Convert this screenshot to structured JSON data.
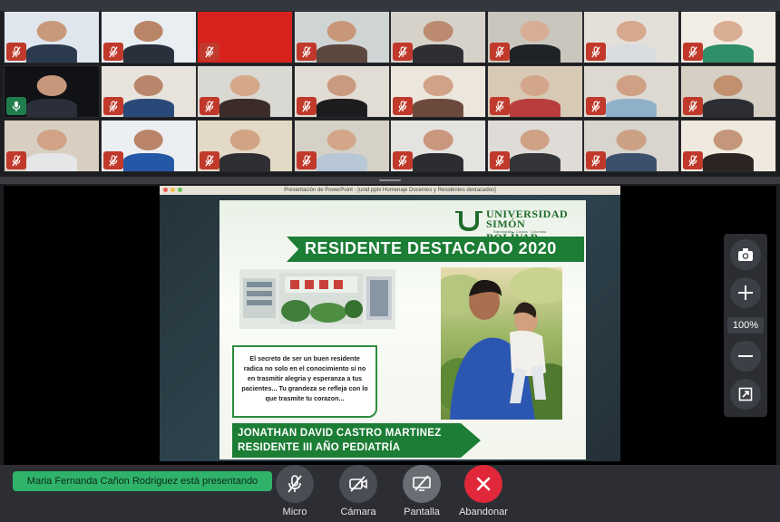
{
  "window": {
    "title": "Presentación de PowerPoint - [unid pptx Homenaje Docentes y Residentes destacados]"
  },
  "participants": [
    {
      "bg": "#dfe6ee",
      "skin": "#c89a7c",
      "cloth": "#2b3a4f",
      "mic": "muted"
    },
    {
      "bg": "#e9eef2",
      "skin": "#b88566",
      "cloth": "#28303c",
      "mic": "muted"
    },
    {
      "bg": "#d9221d",
      "skin": "#d9221d",
      "cloth": "#d9221d",
      "mic": "muted"
    },
    {
      "bg": "#cfd4d4",
      "skin": "#c8977a",
      "cloth": "#5d4840",
      "mic": "muted"
    },
    {
      "bg": "#d6d2c9",
      "skin": "#bb8a6f",
      "cloth": "#2e2e33",
      "mic": "muted"
    },
    {
      "bg": "#c9c6bd",
      "skin": "#d7ad95",
      "cloth": "#1f2227",
      "mic": "muted"
    },
    {
      "bg": "#e3e0da",
      "skin": "#d6a88d",
      "cloth": "#d9dde1",
      "mic": "muted"
    },
    {
      "bg": "#f1ece4",
      "skin": "#d9ad92",
      "cloth": "#2f8f68",
      "mic": "muted"
    },
    {
      "bg": "#111216",
      "skin": "#c7977b",
      "cloth": "#2c2f3a",
      "mic": "on"
    },
    {
      "bg": "#e8e4dd",
      "skin": "#b8876b",
      "cloth": "#294a78",
      "mic": "muted"
    },
    {
      "bg": "#dad8d2",
      "skin": "#d5a889",
      "cloth": "#3b2c28",
      "mic": "muted"
    },
    {
      "bg": "#e1dcd4",
      "skin": "#c99a7e",
      "cloth": "#1d1c1f",
      "mic": "muted"
    },
    {
      "bg": "#ece6dc",
      "skin": "#d0a286",
      "cloth": "#6b4a3d",
      "mic": "muted"
    },
    {
      "bg": "#d8c9b4",
      "skin": "#d3a68b",
      "cloth": "#b93d3d",
      "mic": "muted"
    },
    {
      "bg": "#ddd9d0",
      "skin": "#cfa084",
      "cloth": "#8fb0c9",
      "mic": "muted"
    },
    {
      "bg": "#d5cfc4",
      "skin": "#c0906f",
      "cloth": "#2c2e34",
      "mic": "muted"
    },
    {
      "bg": "#d8cfc2",
      "skin": "#d1a285",
      "cloth": "#e4e6e8",
      "mic": "muted"
    },
    {
      "bg": "#eceff2",
      "skin": "#b98467",
      "cloth": "#2557a7",
      "mic": "muted"
    },
    {
      "bg": "#e2d9c6",
      "skin": "#d2a284",
      "cloth": "#2f2f33",
      "mic": "muted"
    },
    {
      "bg": "#d6d1c7",
      "skin": "#d3a68a",
      "cloth": "#b7c7d6",
      "mic": "muted"
    },
    {
      "bg": "#e4e3e0",
      "skin": "#c9977b",
      "cloth": "#2c2d31",
      "mic": "muted"
    },
    {
      "bg": "#dfdcd7",
      "skin": "#cfa185",
      "cloth": "#343538",
      "mic": "muted"
    },
    {
      "bg": "#d8d4ce",
      "skin": "#ccA083",
      "cloth": "#3c4f6b",
      "mic": "muted"
    },
    {
      "bg": "#efe9df",
      "skin": "#c6967a",
      "cloth": "#2b2422",
      "mic": "muted"
    }
  ],
  "slide": {
    "logo_line1": "UNIVERSIDAD",
    "logo_line2": "SIMÓN BOLÍVAR",
    "logo_sub": "Barranquilla · Cúcuta · Colombia",
    "heading": "RESIDENTE DESTACADO 2020",
    "quote": "El secreto de ser un buen residente radica no solo en el conocimiento si no en trasmitir alegria y esperanza a tus pacientes... Tu grandeza se refleja con lo que trasmite tu corazon...",
    "name": "JONATHAN DAVID CASTRO MARTINEZ",
    "role": "RESIDENTE III AÑO PEDIATRÍA"
  },
  "zoom": {
    "value": "100%"
  },
  "footer": {
    "presenting": "Maria Fernanda Cañon Rodriguez está presentando",
    "controls": {
      "mic": "Micro",
      "camera": "Cámara",
      "screen": "Pantalla",
      "leave": "Abandonar"
    }
  },
  "colors": {
    "accent": "#2fb36a",
    "leave": "#e0283a",
    "slide_green": "#1c7d35",
    "muted_mic": "#c0392b"
  },
  "icons": {
    "mic": "mic-off-icon",
    "camera": "camera-off-icon",
    "screen": "screen-share-off-icon",
    "leave": "close-icon",
    "screenshot": "camera-icon",
    "zoom_in": "plus-icon",
    "zoom_out": "minus-icon",
    "fit": "expand-icon"
  }
}
